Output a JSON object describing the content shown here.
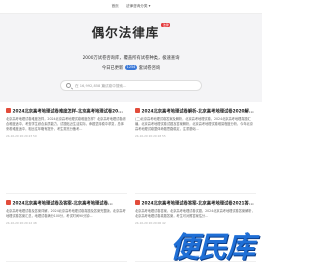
{
  "nav": {
    "items": [
      "首页",
      "法律咨询分类 ▾"
    ]
  },
  "brand": {
    "title": "偶尔法律库",
    "badge": "法律"
  },
  "hero": {
    "slogan": "2000万试卷咨询库，覆盖所有试卷种类，极速查询",
    "today_prefix": "今日已更新",
    "today_count": "1254",
    "today_suffix": "套试卷咨询"
  },
  "search": {
    "placeholder": "在 16,992,858 篇试卷中搜索..."
  },
  "cards": [
    {
      "title": "2024北京高考地理试卷难度怎样-北京高考地理试卷20...",
      "desc": "北京高考地理试卷难度怎样，2024北京高考地理试卷难度怎样？北京高考地理试卷综合难度适中，考查学生综合素质能力，试题贴近生活实际，命题坚持稳中求变，总体来看难度适中，相比往年略有提升，考生需充分备考...",
      "meta": "24-10-29 20:20:23  59"
    },
    {
      "title": "2024北京高考地理试卷解析-北京高考地理试卷2020解...",
      "desc": "(二)北京高考地理试卷答案及解析，北京高考地理试卷，2024北京高考地理真题汇编，北京高考地理试卷试题及答案解析，北京高考地理试卷难易程度分析，今年北京高考地理试卷整体命题思路稳定，注重基础...",
      "meta": "24-10-29 20:20:18  55"
    },
    {
      "title": "2024北京高考地理试卷及答案-北京高考地理试卷...",
      "desc": "北京高考地理试卷及答案详解，2024北京高考地理试卷真题及答案完整版，北京高考地理试卷答案汇总，地理试卷满分100分，考试时间90分钟...",
      "meta": "24-10-29 20:20:12  48"
    },
    {
      "title": "2024北京高考地理试卷答案-北京高考地理试卷2021答...",
      "desc": "北京高考地理试卷答案，北京高考地理试卷试题，2024北京高考地理试卷答案解析，北京高考地理试卷真题答案，考生可对照答案估分...",
      "meta": "24-10-29 20:20:06  42"
    }
  ],
  "watermark": {
    "text": "便民库",
    "sub": "BIANMINKU.COM"
  }
}
